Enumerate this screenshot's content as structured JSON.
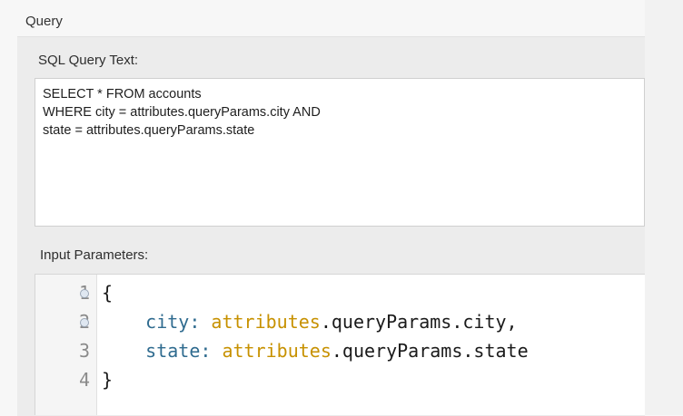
{
  "section": {
    "title": "Query"
  },
  "sql": {
    "label": "SQL Query Text:",
    "text": "SELECT * FROM accounts\nWHERE city = attributes.queryParams.city AND\nstate = attributes.queryParams.state"
  },
  "params": {
    "label": "Input Parameters:",
    "lines": [
      {
        "num": "1",
        "indent": "",
        "key": "",
        "obj": "",
        "rest": "{"
      },
      {
        "num": "2",
        "indent": "    ",
        "key": "city: ",
        "obj": "attributes",
        "rest": ".queryParams.city,"
      },
      {
        "num": "3",
        "indent": "    ",
        "key": "state: ",
        "obj": "attributes",
        "rest": ".queryParams.state"
      },
      {
        "num": "4",
        "indent": "",
        "key": "",
        "obj": "",
        "rest": "}"
      }
    ]
  },
  "colors": {
    "key": "#2f6b8f",
    "object": "#c79100",
    "gutter": "#f5f5f5"
  }
}
